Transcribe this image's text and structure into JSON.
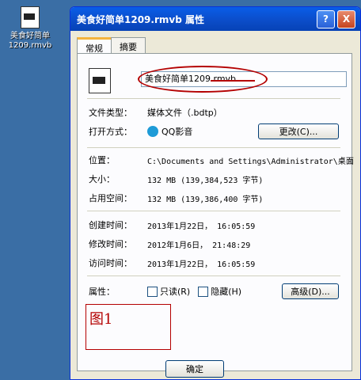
{
  "desktop": {
    "icon_label": "美食好简单\n1209.rmvb"
  },
  "window": {
    "title": "美食好简单1209.rmvb 属性",
    "buttons": {
      "help": "?",
      "close": "X"
    }
  },
  "tabs": [
    {
      "label": "常规"
    },
    {
      "label": "摘要"
    }
  ],
  "fields": {
    "filename": "美食好简单1209.rmvb",
    "file_type_label": "文件类型：",
    "file_type_value": "媒体文件（.bdtp）",
    "open_with_label": "打开方式：",
    "open_with_value": "QQ影音",
    "change_button": "更改(C)...",
    "location_label": "位置：",
    "location_value": "C:\\Documents and Settings\\Administrator\\桌面",
    "size_label": "大小：",
    "size_value": "132 MB (139,384,523 字节)",
    "disk_size_label": "占用空间：",
    "disk_size_value": "132 MB (139,386,400 字节)",
    "created_label": "创建时间：",
    "created_value": "2013年1月22日， 16:05:59",
    "modified_label": "修改时间：",
    "modified_value": "2012年1月6日， 21:48:29",
    "accessed_label": "访问时间：",
    "accessed_value": "2013年1月22日， 16:05:59",
    "attributes_label": "属性：",
    "readonly_label": "只读(R)",
    "hidden_label": "隐藏(H)",
    "advanced_button": "高级(D)..."
  },
  "annotation": {
    "figure_label": "图1"
  },
  "footer": {
    "ok": "确定"
  }
}
